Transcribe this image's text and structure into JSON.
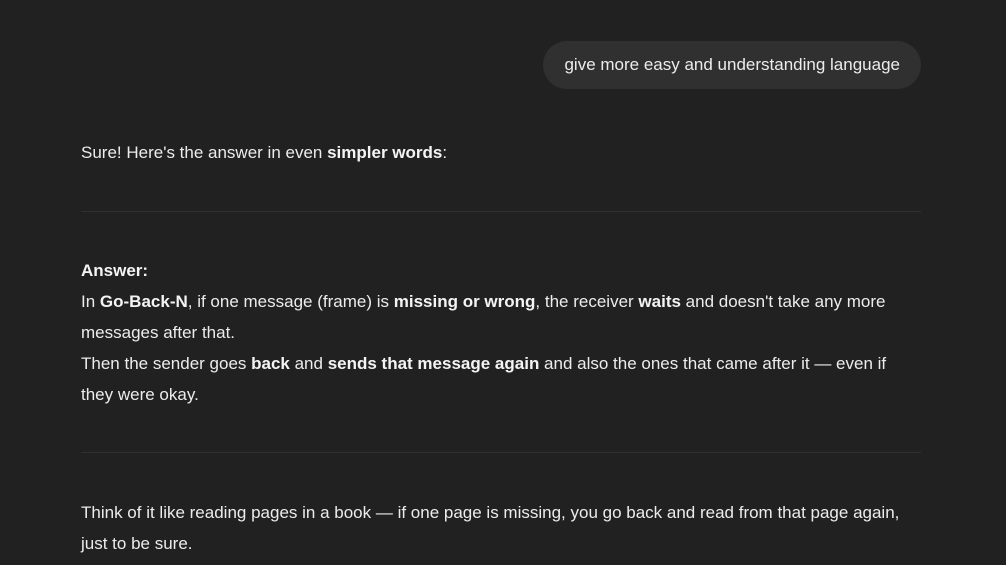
{
  "user_message": "give more easy and understanding language",
  "assistant": {
    "intro": {
      "prefix": "Sure! Here's the answer in even ",
      "bold": "simpler words",
      "suffix": ":"
    },
    "answer_label": "Answer:",
    "paragraph1": {
      "t1": "In ",
      "b1": "Go-Back-N",
      "t2": ", if one message (frame) is ",
      "b2": "missing or wrong",
      "t3": ", the receiver ",
      "b3": "waits",
      "t4": " and doesn't take any more messages after that."
    },
    "paragraph2": {
      "t1": "Then the sender goes ",
      "b1": "back",
      "t2": " and ",
      "b2": "sends that message again",
      "t3": " and also the ones that came after it — even if they were okay."
    },
    "analogy": "Think of it like reading pages in a book — if one page is missing, you go back and read from that page again, just to be sure."
  },
  "colors": {
    "background": "#212121",
    "bubble": "#303030",
    "text": "#ececec",
    "divider": "#2f2f2f"
  }
}
